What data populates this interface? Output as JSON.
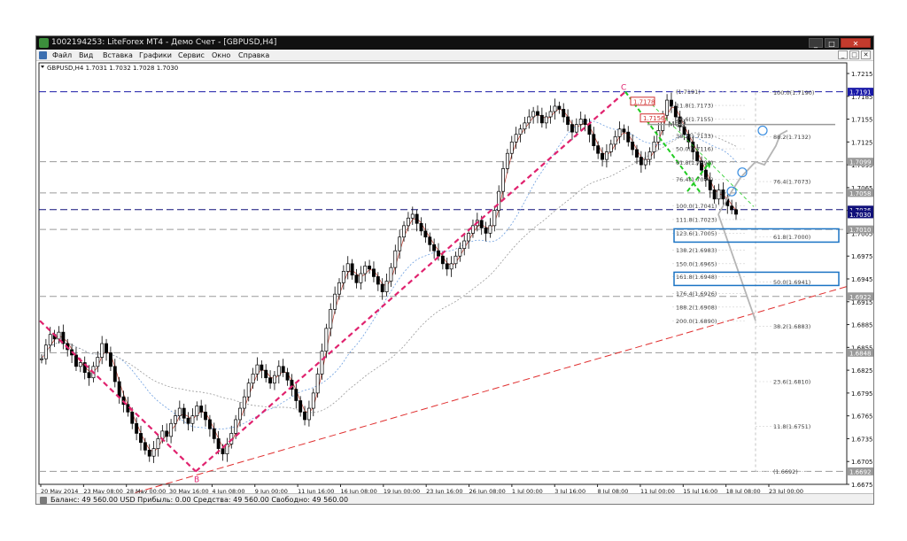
{
  "window": {
    "title": "1002194253: LiteForex MT4 - Демо Счет - [GBPUSD,H4]",
    "controls": [
      "_",
      "□",
      "✕"
    ]
  },
  "menu": {
    "items": [
      "Файл",
      "Вид",
      "Вставка",
      "Графики",
      "Сервис",
      "Окно",
      "Справка"
    ],
    "mdi_controls": [
      "_",
      "□",
      "✕"
    ]
  },
  "chart_data": {
    "type": "candlestick",
    "symbol_line": "GBPUSD,H4  1.7031 1.7032 1.7028 1.7030",
    "ylim": [
      1.6675,
      1.7215
    ],
    "price_ticks": [
      "1.7215",
      "1.7185",
      "1.7155",
      "1.7125",
      "1.7095",
      "1.7065",
      "1.7035",
      "1.7005",
      "1.6975",
      "1.6945",
      "1.6915",
      "1.6885",
      "1.6855",
      "1.6825",
      "1.6795",
      "1.6765",
      "1.6735",
      "1.6705",
      "1.6675"
    ],
    "time_ticks": [
      "20 May 2014",
      "23 May 08:00",
      "28 May 00:00",
      "30 May 16:00",
      "4 Jun 08:00",
      "9 Jun 00:00",
      "11 Jun 16:00",
      "16 Jun 08:00",
      "19 Jun 00:00",
      "23 Jun 16:00",
      "26 Jun 08:00",
      "1 Jul 00:00",
      "3 Jul 16:00",
      "8 Jul 08:00",
      "11 Jul 00:00",
      "15 Jul 16:00",
      "18 Jul 08:00",
      "23 Jul 00:00"
    ],
    "price_labels": [
      {
        "value": 1.7191,
        "text": "1.7191",
        "color": "#1a1aa8"
      },
      {
        "value": 1.7099,
        "text": "1.7099",
        "color": "#9a9a9a"
      },
      {
        "value": 1.7058,
        "text": "1.7058",
        "color": "#9a9a9a"
      },
      {
        "value": 1.7036,
        "text": "1.7036",
        "color": "#10107a"
      },
      {
        "value": 1.703,
        "text": "1.7030",
        "color": "#ffffff"
      },
      {
        "value": 1.701,
        "text": "1.7010",
        "color": "#9a9a9a"
      },
      {
        "value": 1.6922,
        "text": "1.6922",
        "color": "#9a9a9a"
      },
      {
        "value": 1.6848,
        "text": "1.6848",
        "color": "#9a9a9a"
      },
      {
        "value": 1.6692,
        "text": "1.6692",
        "color": "#9a9a9a"
      }
    ],
    "horizontal_levels": [
      {
        "value": 1.7191,
        "color": "#1a1aa8",
        "dash": "8,4"
      },
      {
        "value": 1.7099,
        "color": "#9a9a9a",
        "dash": "8,4"
      },
      {
        "value": 1.7058,
        "color": "#9a9a9a",
        "dash": "8,4"
      },
      {
        "value": 1.7036,
        "color": "#10107a",
        "dash": "8,4"
      },
      {
        "value": 1.701,
        "color": "#9a9a9a",
        "dash": "8,4"
      },
      {
        "value": 1.6922,
        "color": "#9a9a9a",
        "dash": "8,4"
      },
      {
        "value": 1.6848,
        "color": "#9a9a9a",
        "dash": "8,4"
      },
      {
        "value": 1.6692,
        "color": "#9a9a9a",
        "dash": "8,4"
      }
    ],
    "fib_left": [
      "(1.7191)",
      "11.8(1.7173)",
      "23.6(1.7155)",
      "38.2(1.7133)",
      "50.0(1.7116)",
      "61.8(1.7098)",
      "76.4(1.7076)",
      "100.0(1.7041)",
      "111.8(1.7023)",
      "123.6(1.7005)",
      "138.2(1.6983)",
      "150.0(1.6965)",
      "161.8(1.6948)",
      "176.4(1.6926)",
      "188.2(1.6908)",
      "200.0(1.6890)"
    ],
    "fib_left_values": [
      1.7191,
      1.7173,
      1.7155,
      1.7133,
      1.7116,
      1.7098,
      1.7076,
      1.7041,
      1.7023,
      1.7005,
      1.6983,
      1.6965,
      1.6948,
      1.6926,
      1.6908,
      1.689
    ],
    "fib_right": [
      "100.0(1.7190)",
      "88.2(1.7132)",
      "76.4(1.7073)",
      "61.8(1.7000)",
      "50.0(1.6941)",
      "38.2(1.6883)",
      "23.6(1.6810)",
      "11.8(1.6751)",
      "(1.6692)"
    ],
    "fib_right_values": [
      1.719,
      1.7132,
      1.7073,
      1.7,
      1.6941,
      1.6883,
      1.681,
      1.6751,
      1.6692
    ],
    "marks": {
      "point_b": "B",
      "point_c": "C",
      "mf2": "МФ2",
      "box_1": "1.7178",
      "box_2": "1.7156"
    },
    "mark_values": {
      "point_b": 1.6692,
      "point_c": 1.7191,
      "mf2": 1.7148,
      "box_1": 1.7178,
      "box_2": 1.7156
    },
    "candles": [
      1.684,
      1.6858,
      1.6872,
      1.6866,
      1.6875,
      1.686,
      1.6852,
      1.6845,
      1.683,
      1.6835,
      1.6822,
      1.6815,
      1.683,
      1.6842,
      1.686,
      1.6848,
      1.683,
      1.681,
      1.679,
      1.678,
      1.677,
      1.6755,
      1.6742,
      1.673,
      1.672,
      1.6712,
      1.6722,
      1.6735,
      1.6745,
      1.6738,
      1.6755,
      1.6765,
      1.6775,
      1.6762,
      1.6755,
      1.6765,
      1.6778,
      1.677,
      1.676,
      1.6748,
      1.6735,
      1.6722,
      1.6715,
      1.6728,
      1.6742,
      1.676,
      1.6775,
      1.679,
      1.6808,
      1.682,
      1.6832,
      1.6825,
      1.6815,
      1.6808,
      1.6818,
      1.683,
      1.6822,
      1.6812,
      1.68,
      1.6785,
      1.677,
      1.676,
      1.6775,
      1.6795,
      1.682,
      1.685,
      1.688,
      1.6905,
      1.6925,
      1.694,
      1.6955,
      1.6965,
      1.695,
      1.694,
      1.6952,
      1.6962,
      1.6958,
      1.6948,
      1.6938,
      1.6928,
      1.6942,
      1.696,
      1.6982,
      1.7,
      1.7015,
      1.7025,
      1.703,
      1.7018,
      1.7008,
      1.7,
      1.699,
      1.6982,
      1.6975,
      1.6965,
      1.6958,
      1.6965,
      1.6975,
      1.6985,
      1.6995,
      1.7005,
      1.7015,
      1.7022,
      1.7012,
      1.7005,
      1.7015,
      1.7035,
      1.706,
      1.709,
      1.711,
      1.7125,
      1.7135,
      1.7142,
      1.715,
      1.7158,
      1.7165,
      1.716,
      1.715,
      1.7158,
      1.7165,
      1.7172,
      1.7168,
      1.7158,
      1.7148,
      1.7138,
      1.7148,
      1.7155,
      1.7148,
      1.7135,
      1.712,
      1.711,
      1.7102,
      1.7112,
      1.7122,
      1.7132,
      1.7142,
      1.7138,
      1.7125,
      1.7115,
      1.7105,
      1.7095,
      1.7102,
      1.7112,
      1.7125,
      1.714,
      1.716,
      1.718,
      1.7172,
      1.7158,
      1.7145,
      1.7135,
      1.7125,
      1.7112,
      1.71,
      1.7088,
      1.7075,
      1.7062,
      1.705,
      1.7062,
      1.705,
      1.7041,
      1.7036,
      1.703
    ]
  },
  "status": {
    "text": "Баланс: 49 560.00 USD  Прибыль: 0.00  Средства: 49 560.00  Свободно: 49 560.00"
  }
}
